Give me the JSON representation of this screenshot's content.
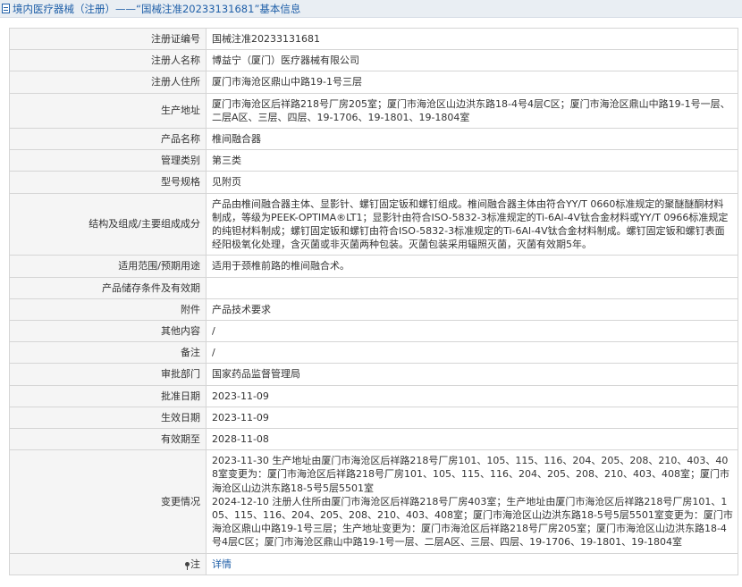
{
  "header": {
    "breadcrumb_link": "境内医疗器械（注册）",
    "separator": " ——",
    "title": "“国械注准20233131681”基本信息"
  },
  "rows": [
    {
      "label": "注册证编号",
      "value": "国械注准20233131681"
    },
    {
      "label": "注册人名称",
      "value": "博益宁（厦门）医疗器械有限公司"
    },
    {
      "label": "注册人住所",
      "value": "厦门市海沧区鼎山中路19-1号三层"
    },
    {
      "label": "生产地址",
      "value": "厦门市海沧区后祥路218号厂房205室；厦门市海沧区山边洪东路18-4号4层C区；厦门市海沧区鼎山中路19-1号一层、二层A区、三层、四层、19-1706、19-1801、19-1804室"
    },
    {
      "label": "产品名称",
      "value": "椎间融合器"
    },
    {
      "label": "管理类别",
      "value": "第三类"
    },
    {
      "label": "型号规格",
      "value": "见附页"
    },
    {
      "label": "结构及组成/主要组成成分",
      "value": "产品由椎间融合器主体、显影针、螺钉固定钣和螺钉组成。椎间融合器主体由符合YY/T 0660标准规定的聚醚醚酮材料制成，等级为PEEK-OPTIMA®LT1；显影针由符合ISO-5832-3标准规定的Ti-6Al-4V钛合金材料或YY/T 0966标准规定的纯钽材料制成；螺钉固定钣和螺钉由符合ISO-5832-3标准规定的Ti-6Al-4V钛合金材料制成。螺钉固定钣和螺钉表面经阳极氧化处理，含灭菌或非灭菌两种包装。灭菌包装采用辐照灭菌，灭菌有效期5年。"
    },
    {
      "label": "适用范围/预期用途",
      "value": "适用于颈椎前路的椎间融合术。"
    },
    {
      "label": "产品储存条件及有效期",
      "value": ""
    },
    {
      "label": "附件",
      "value": "产品技术要求"
    },
    {
      "label": "其他内容",
      "value": "/"
    },
    {
      "label": "备注",
      "value": "/"
    },
    {
      "label": "审批部门",
      "value": "国家药品监督管理局"
    },
    {
      "label": "批准日期",
      "value": "2023-11-09"
    },
    {
      "label": "生效日期",
      "value": "2023-11-09"
    },
    {
      "label": "有效期至",
      "value": "2028-11-08"
    },
    {
      "label": "变更情况",
      "value": "2023-11-30 生产地址由厦门市海沧区后祥路218号厂房101、105、115、116、204、205、208、210、403、408室变更为：厦门市海沧区后祥路218号厂房101、105、115、116、204、205、208、210、403、408室；厦门市海沧区山边洪东路18-5号5层5501室\n2024-12-10 注册人住所由厦门市海沧区后祥路218号厂房403室；生产地址由厦门市海沧区后祥路218号厂房101、105、115、116、204、205、208、210、403、408室；厦门市海沧区山边洪东路18-5号5层5501室变更为：厦门市海沧区鼎山中路19-1号三层；生产地址变更为：厦门市海沧区后祥路218号厂房205室；厦门市海沧区山边洪东路18-4号4层C区；厦门市海沧区鼎山中路19-1号一层、二层A区、三层、四层、19-1706、19-1801、19-1804室"
    }
  ],
  "note_row": {
    "label": "注",
    "link_text": "详情"
  }
}
